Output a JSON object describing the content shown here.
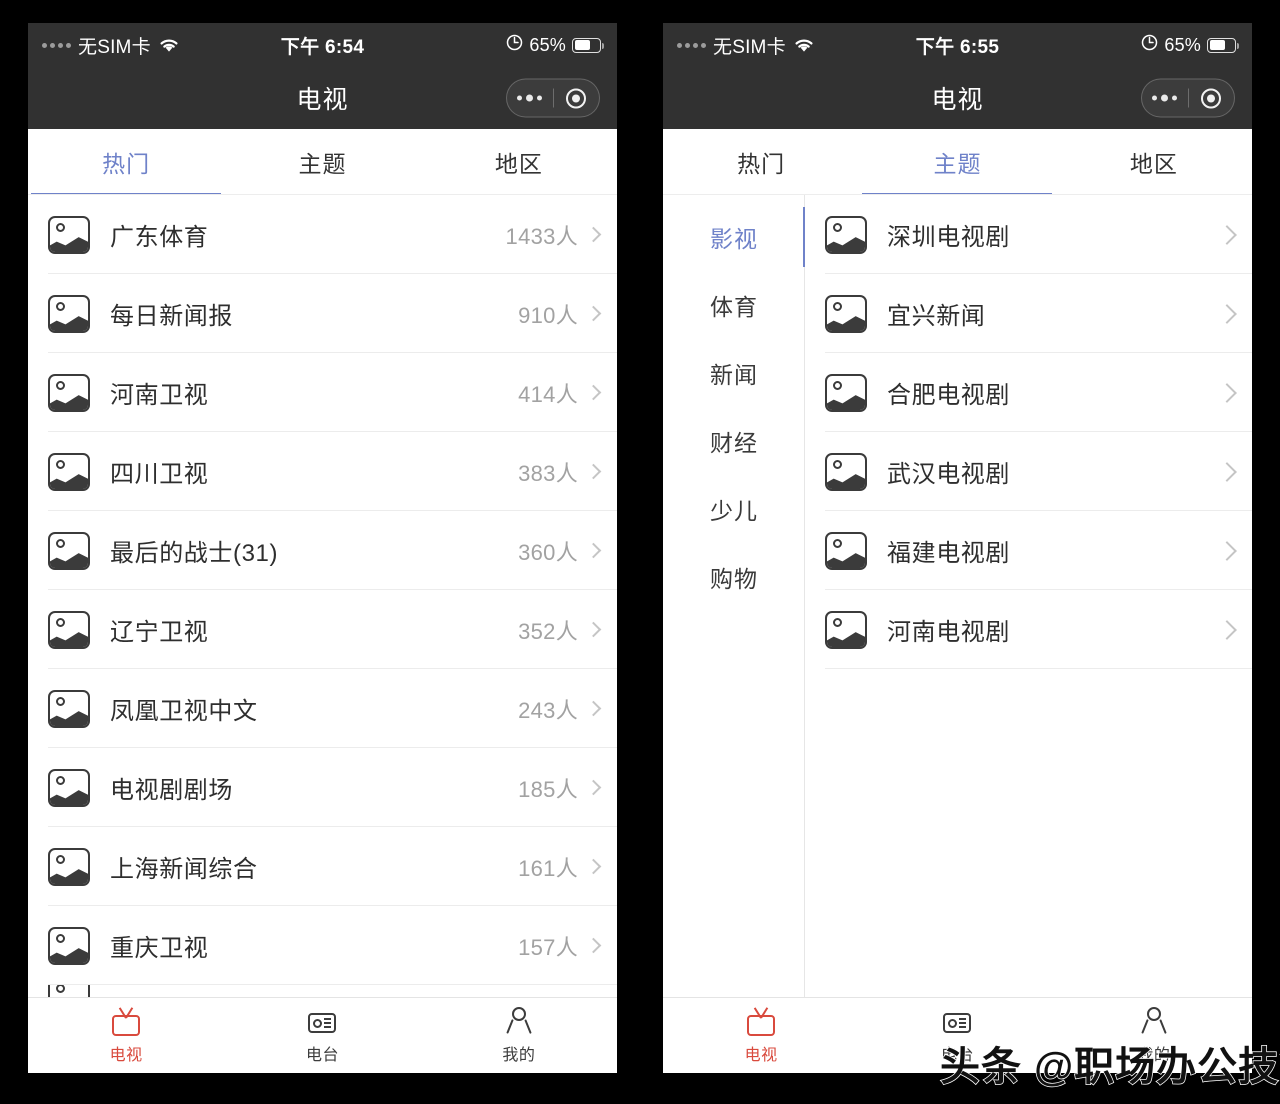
{
  "colors": {
    "accent_blue": "#6f82c9",
    "accent_red": "#d94a3d",
    "navbar_bg": "#313131",
    "count_gray": "#a2a2a2",
    "chevron_gray": "#c5c5c5"
  },
  "left_phone": {
    "status_bar": {
      "carrier": "无SIM卡",
      "time": "下午 6:54",
      "battery_percent": "65%",
      "wifi_icon": "wifi-icon",
      "signal_icon": "signal-dots-icon",
      "location_icon": "location-services-icon",
      "battery_icon": "battery-icon"
    },
    "navbar": {
      "title": "电视",
      "capsule": {
        "more_icon": "more-dots-icon",
        "target_icon": "target-circle-icon"
      }
    },
    "tabs": [
      {
        "label": "热门",
        "active": true
      },
      {
        "label": "主题",
        "active": false
      },
      {
        "label": "地区",
        "active": false
      }
    ],
    "list": [
      {
        "name": "广东体育",
        "count": "1433人"
      },
      {
        "name": "每日新闻报",
        "count": "910人"
      },
      {
        "name": "河南卫视",
        "count": "414人"
      },
      {
        "name": "四川卫视",
        "count": "383人"
      },
      {
        "name": "最后的战士(31)",
        "count": "360人"
      },
      {
        "name": "辽宁卫视",
        "count": "352人"
      },
      {
        "name": "凤凰卫视中文",
        "count": "243人"
      },
      {
        "name": "电视剧剧场",
        "count": "185人"
      },
      {
        "name": "上海新闻综合",
        "count": "161人"
      },
      {
        "name": "重庆卫视",
        "count": "157人"
      }
    ],
    "tabbar": [
      {
        "label": "电视",
        "icon": "tv-icon",
        "active": true
      },
      {
        "label": "电台",
        "icon": "radio-icon",
        "active": false
      },
      {
        "label": "我的",
        "icon": "person-icon",
        "active": false
      }
    ]
  },
  "right_phone": {
    "status_bar": {
      "carrier": "无SIM卡",
      "time": "下午 6:55",
      "battery_percent": "65%",
      "wifi_icon": "wifi-icon",
      "signal_icon": "signal-dots-icon",
      "location_icon": "location-services-icon",
      "battery_icon": "battery-icon"
    },
    "navbar": {
      "title": "电视",
      "capsule": {
        "more_icon": "more-dots-icon",
        "target_icon": "target-circle-icon"
      }
    },
    "tabs": [
      {
        "label": "热门",
        "active": false
      },
      {
        "label": "主题",
        "active": true
      },
      {
        "label": "地区",
        "active": false
      }
    ],
    "categories": [
      {
        "label": "影视",
        "active": true
      },
      {
        "label": "体育",
        "active": false
      },
      {
        "label": "新闻",
        "active": false
      },
      {
        "label": "财经",
        "active": false
      },
      {
        "label": "少儿",
        "active": false
      },
      {
        "label": "购物",
        "active": false
      }
    ],
    "list": [
      {
        "name": "深圳电视剧"
      },
      {
        "name": "宜兴新闻"
      },
      {
        "name": "合肥电视剧"
      },
      {
        "name": "武汉电视剧"
      },
      {
        "name": "福建电视剧"
      },
      {
        "name": "河南电视剧"
      }
    ],
    "tabbar": [
      {
        "label": "电视",
        "icon": "tv-icon",
        "active": true
      },
      {
        "label": "电台",
        "icon": "radio-icon",
        "active": false
      },
      {
        "label": "我的",
        "icon": "person-icon",
        "active": false
      }
    ]
  },
  "watermark": {
    "text": "头条 @职场办公技能"
  }
}
